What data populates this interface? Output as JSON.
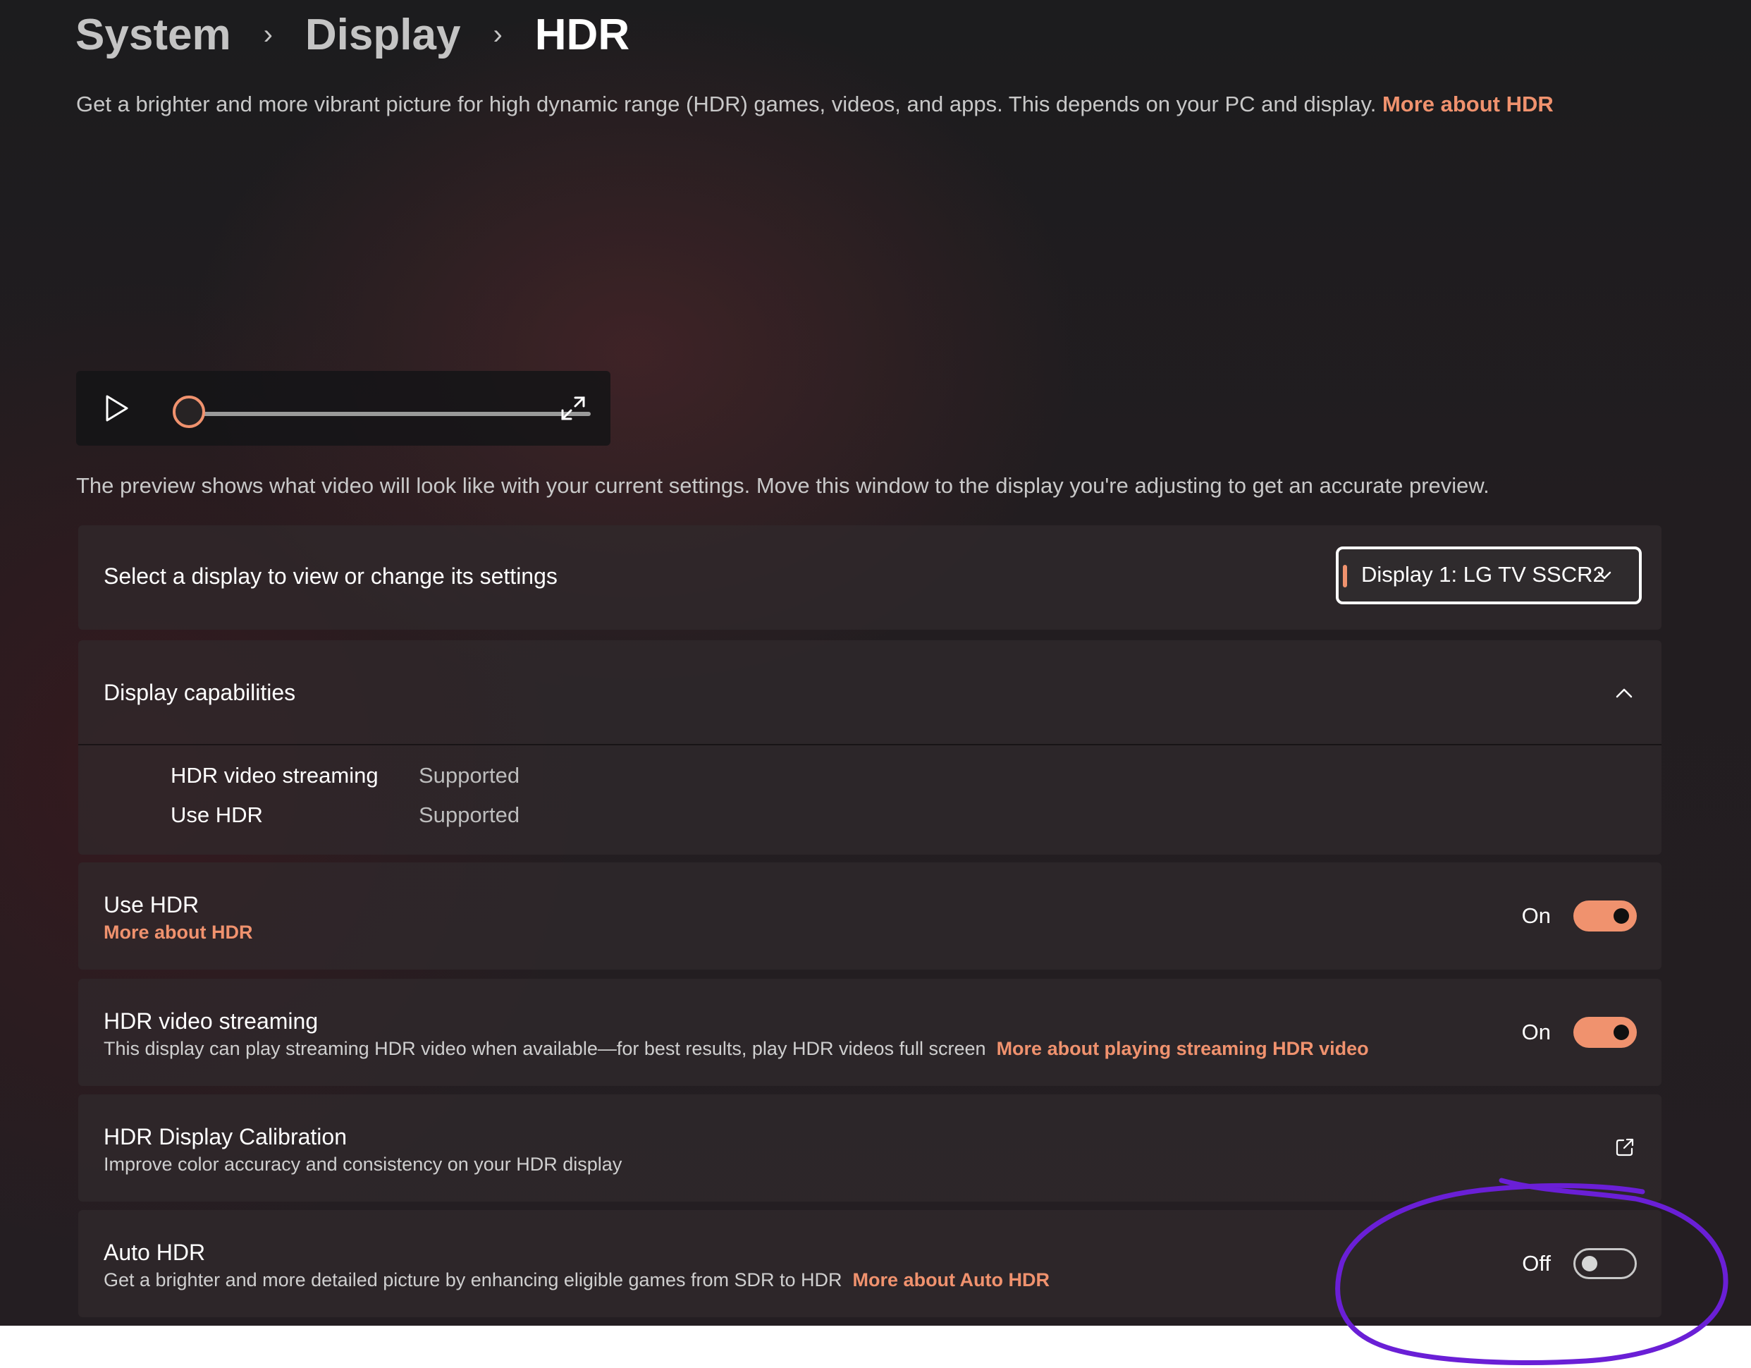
{
  "breadcrumb": {
    "items": [
      "System",
      "Display"
    ],
    "current": "HDR",
    "separator_icon": "chevron-right-icon"
  },
  "intro": {
    "text": "Get a brighter and more vibrant picture for high dynamic range (HDR) games, videos, and apps. This depends on your PC and display.",
    "link": "More about HDR"
  },
  "player": {
    "play_icon": "play-icon",
    "fullscreen_icon": "expand-icon",
    "progress": 0
  },
  "preview_note": "The preview shows what video will look like with your current settings. Move this window to the display you're adjusting to get an accurate preview.",
  "display_select": {
    "label": "Select a display to view or change its settings",
    "selected": "Display 1: LG TV SSCR2"
  },
  "capabilities": {
    "title": "Display capabilities",
    "rows": [
      {
        "label": "HDR video streaming",
        "value": "Supported"
      },
      {
        "label": "Use HDR",
        "value": "Supported"
      }
    ]
  },
  "settings": {
    "use_hdr": {
      "title": "Use HDR",
      "link": "More about HDR",
      "state": "On"
    },
    "hdr_streaming": {
      "title": "HDR video streaming",
      "desc": "This display can play streaming HDR video when available—for best results, play HDR videos full screen",
      "link": "More about playing streaming HDR video",
      "state": "On"
    },
    "calibration": {
      "title": "HDR Display Calibration",
      "desc": "Improve color accuracy and consistency on your HDR display"
    },
    "auto_hdr": {
      "title": "Auto HDR",
      "desc": "Get a brighter and more detailed picture by enhancing eligible games from SDR to HDR",
      "link": "More about Auto HDR",
      "state": "Off"
    }
  },
  "colors": {
    "accent": "#f0926e",
    "annotation": "#6a1fd6"
  }
}
